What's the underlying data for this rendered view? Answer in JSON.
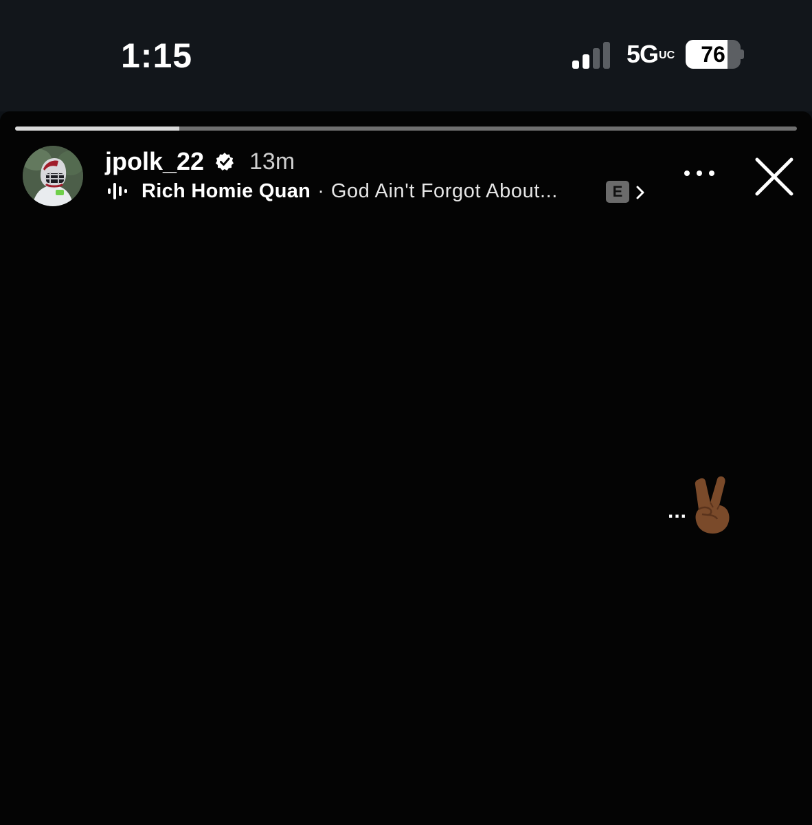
{
  "status_bar": {
    "time": "1:15",
    "network": "5G",
    "network_suffix": "UC",
    "signal_bars_active": 2,
    "signal_bars_total": 4,
    "battery_percent": 76,
    "battery_label": "76"
  },
  "story": {
    "progress_fraction": 0.21,
    "user": {
      "username": "jpolk_22",
      "verified": true,
      "time_ago": "13m",
      "avatar_icon": "football-player-avatar"
    },
    "music": {
      "icon": "audio-wave-icon",
      "artist": "Rich Homie Quan",
      "separator": "·",
      "song": "God Ain't Forgot About...",
      "explicit_badge": "E"
    },
    "actions": {
      "more_icon": "more-horizontal-icon",
      "close_icon": "close-icon"
    },
    "content": {
      "text": "...",
      "emoji": "victory-hand-medium-dark-skin-tone"
    }
  },
  "colors": {
    "status_bg": "#12161b",
    "story_bg": "#040404",
    "progress_track": "#6f6f6f",
    "progress_fill": "#d9d9d9",
    "verified_badge": "#ffffff"
  }
}
